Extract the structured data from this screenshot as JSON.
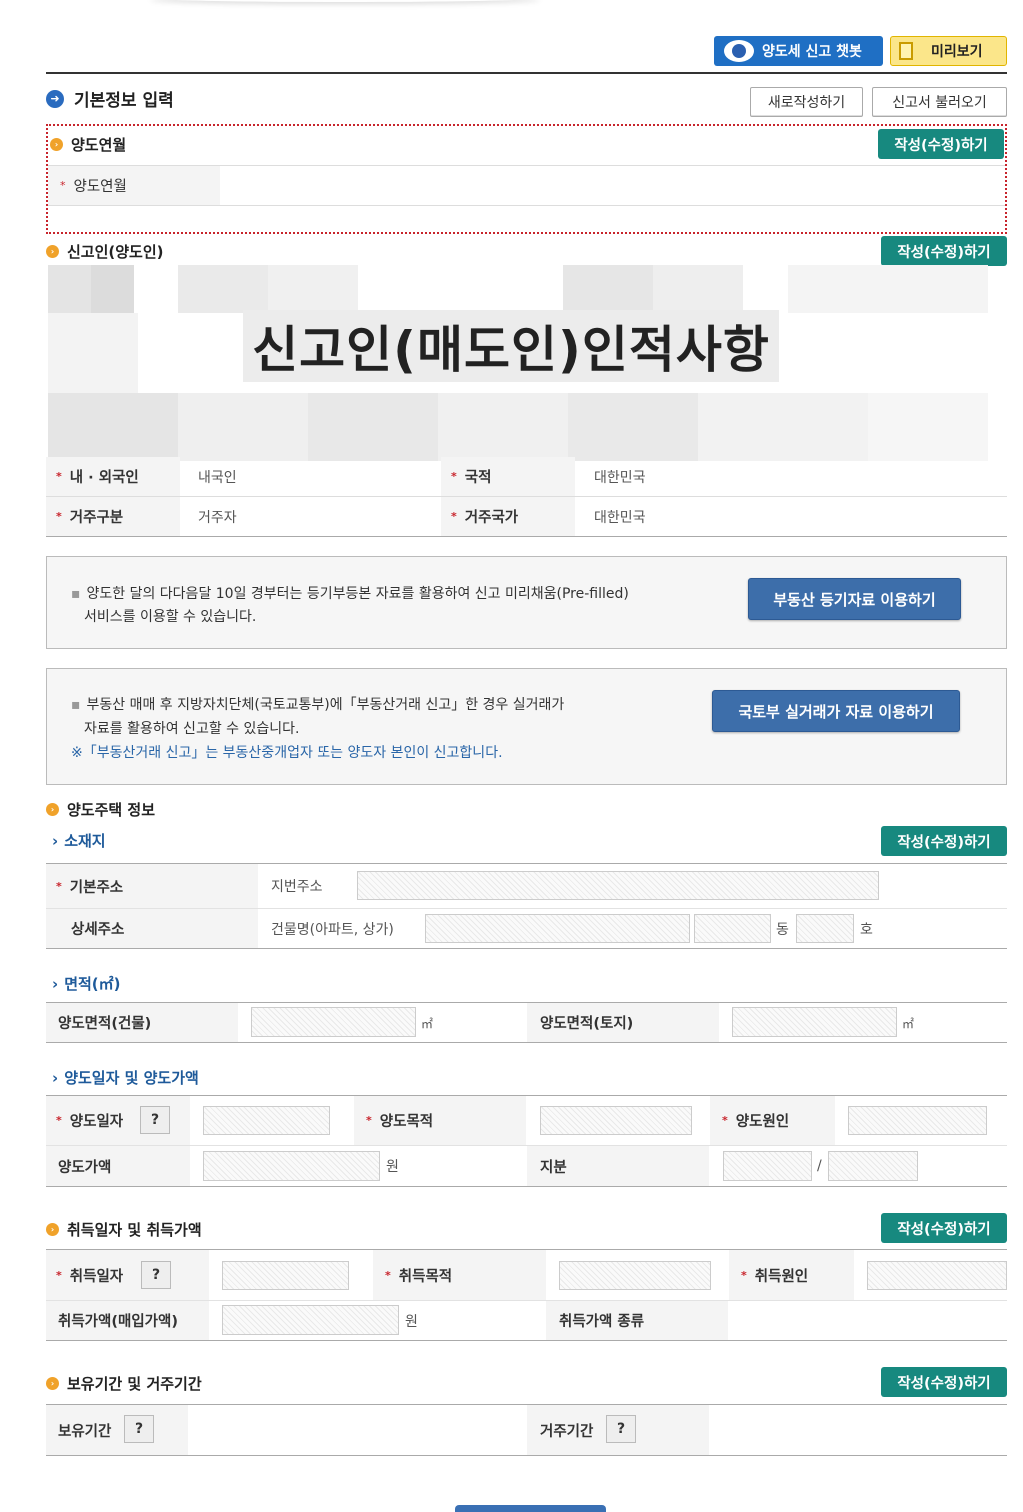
{
  "top": {
    "chatbot_label": "양도세 신고 챗봇",
    "preview_label": "미리보기"
  },
  "main": {
    "title": "기본정보 입력",
    "new_label": "새로작성하기",
    "load_label": "신고서 불러오기"
  },
  "edit_label": "작성(수정)하기",
  "transfer_month": {
    "section": "양도연월",
    "label": "양도연월",
    "value": ""
  },
  "reporter": {
    "section": "신고인(양도인)",
    "blurred_title": "신고인(매도인)인적사항",
    "rows": [
      {
        "l1": "내 · 외국인",
        "v1": "내국인",
        "l2": "국적",
        "v2": "대한민국"
      },
      {
        "l1": "거주구분",
        "v1": "거주자",
        "l2": "거주국가",
        "v2": "대한민국"
      }
    ]
  },
  "notice1": {
    "line1": "양도한 달의 다다음달 10일 경부터는 등기부등본 자료를 활용하여 신고 미리채움(Pre-filled)",
    "line2": "서비스를 이용할 수 있습니다.",
    "button": "부동산 등기자료 이용하기"
  },
  "notice2": {
    "line1": "부동산 매매 후 지방자치단체(국토교통부)에「부동산거래 신고」한 경우 실거래가",
    "line2": "자료를 활용하여 신고할 수 있습니다.",
    "note": "※「부동산거래 신고」는 부동산중개업자 또는 양도자 본인이 신고합니다.",
    "button": "국토부 실거래가 자료 이용하기"
  },
  "house": {
    "section": "양도주택 정보",
    "location": {
      "title": "소재지",
      "basic_label": "기본주소",
      "basic_sub": "지번주소",
      "detail_label": "상세주소",
      "detail_sub": "건물명(아파트, 상가)",
      "dong": "동",
      "ho": "호"
    },
    "area": {
      "title": "면적(㎡)",
      "building_label": "양도면적(건물)",
      "land_label": "양도면적(토지)",
      "unit": "㎡"
    },
    "date_price": {
      "title": "양도일자 및 양도가액",
      "date_label": "양도일자",
      "purpose_label": "양도목적",
      "cause_label": "양도원인",
      "price_label": "양도가액",
      "won": "원",
      "share_label": "지분",
      "slash": "/"
    }
  },
  "acquisition": {
    "section": "취득일자 및 취득가액",
    "date_label": "취득일자",
    "purpose_label": "취득목적",
    "cause_label": "취득원인",
    "price_label": "취득가액(매입가액)",
    "won": "원",
    "type_label": "취득가액 종류"
  },
  "holding": {
    "section": "보유기간 및 거주기간",
    "hold_label": "보유기간",
    "reside_label": "거주기간"
  },
  "help_mark": "?",
  "req_mark": "*"
}
